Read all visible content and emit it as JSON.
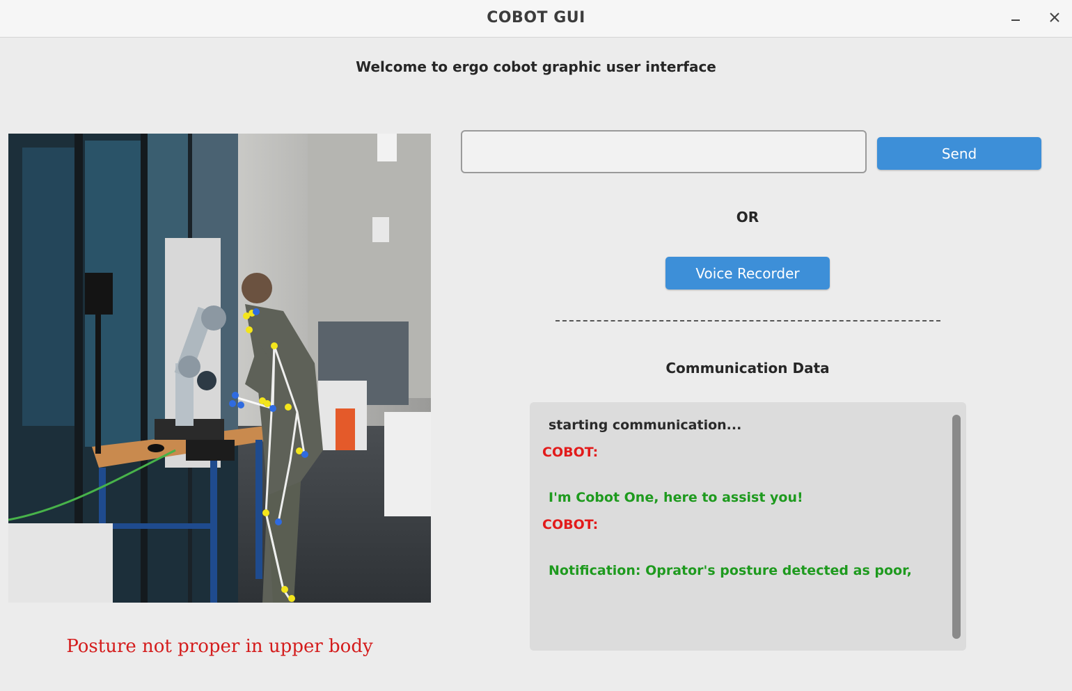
{
  "window": {
    "title": "COBOT GUI",
    "minimize_glyph": "–",
    "close_glyph": "✕"
  },
  "header": {
    "welcome_text": "Welcome to ergo cobot graphic user interface"
  },
  "camera": {
    "icon": "camera-feed-image",
    "posture_status": "Posture not proper in upper body",
    "posture_status_color": "#d41c1c"
  },
  "input": {
    "value": "",
    "placeholder": ""
  },
  "buttons": {
    "send_label": "Send",
    "or_label": "OR",
    "voice_label": "Voice Recorder",
    "accent_color": "#3d8fd8"
  },
  "communication": {
    "title": "Communication Data",
    "lines": [
      {
        "text": "starting communication...",
        "color": "#2a2a2a"
      },
      {
        "text": "COBOT:",
        "color": "#e21b1b"
      },
      {
        "text": "I'm Cobot One, here to assist you!",
        "color": "#1e9a1e"
      },
      {
        "text": "COBOT:",
        "color": "#e21b1b"
      },
      {
        "text": "Notification: Oprator's posture detected as poor,",
        "color": "#1e9a1e"
      }
    ]
  }
}
